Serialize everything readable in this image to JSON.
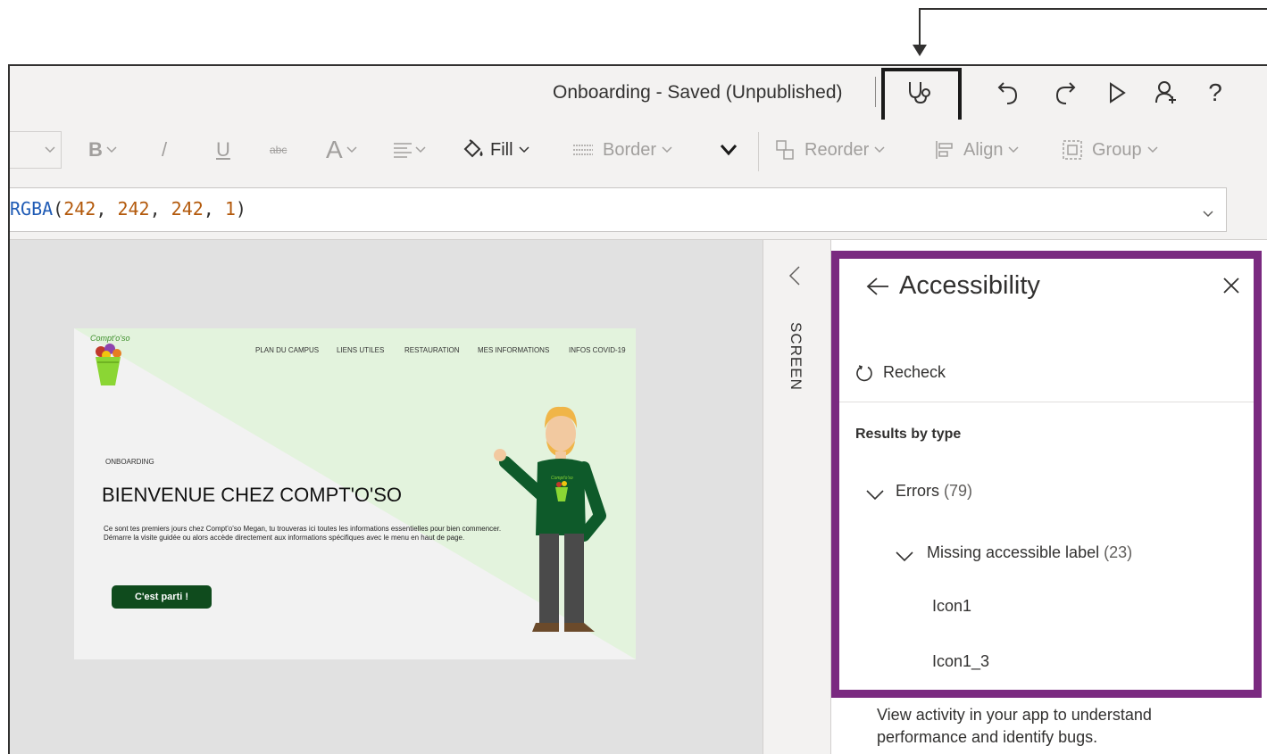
{
  "app": {
    "title": "Onboarding - Saved (Unpublished)"
  },
  "toolbar": {
    "icons": [
      "stethoscope-icon",
      "undo-icon",
      "redo-icon",
      "play-icon",
      "add-user-icon",
      "help-icon"
    ],
    "help_label": "?"
  },
  "ribbon": {
    "bold_label": "B",
    "italic_label": "/",
    "underline_label": "U",
    "strikethrough_label": "abc",
    "font_color_label": "A",
    "fill_label": "Fill",
    "border_label": "Border",
    "reorder_label": "Reorder",
    "align_label": "Align",
    "group_label": "Group"
  },
  "formula": {
    "fn": "RGBA",
    "open": "(",
    "r": "242",
    "sep1": ", ",
    "g": "242",
    "sep2": ", ",
    "b": "242",
    "sep3": ", ",
    "a": "1",
    "close": ")"
  },
  "screen_tab": {
    "label": "SCREEN"
  },
  "preview": {
    "logo": "Compt'o'so",
    "nav": [
      "PLAN DU CAMPUS",
      "LIENS UTILES",
      "RESTAURATION",
      "MES INFORMATIONS",
      "INFOS COVID-19"
    ],
    "eyebrow": "ONBOARDING",
    "headline": "BIENVENUE CHEZ COMPT'O'SO",
    "intro": "Ce sont tes premiers jours chez Compt'o'so Megan, tu trouveras ici toutes les informations essentielles pour bien commencer. Démarre la visite guidée ou alors accède directement aux informations spécifiques avec le menu en haut de page.",
    "cta": "C'est parti !",
    "shirt_text": "Compt'o'so"
  },
  "accessibility": {
    "title": "Accessibility",
    "recheck": "Recheck",
    "results_by_type": "Results by type",
    "errors_label": "Errors",
    "errors_count": "(79)",
    "missing_label": "Missing accessible label",
    "missing_count": "(23)",
    "items": [
      "Icon1",
      "Icon1_3"
    ]
  },
  "activity": {
    "text": "View activity in your app to understand performance and identify bugs."
  },
  "colors": {
    "accent_panel": "#7a2a80",
    "button_green": "#0f4b1d",
    "formula_fn": "#1f5bb5",
    "formula_num": "#b3590b"
  }
}
